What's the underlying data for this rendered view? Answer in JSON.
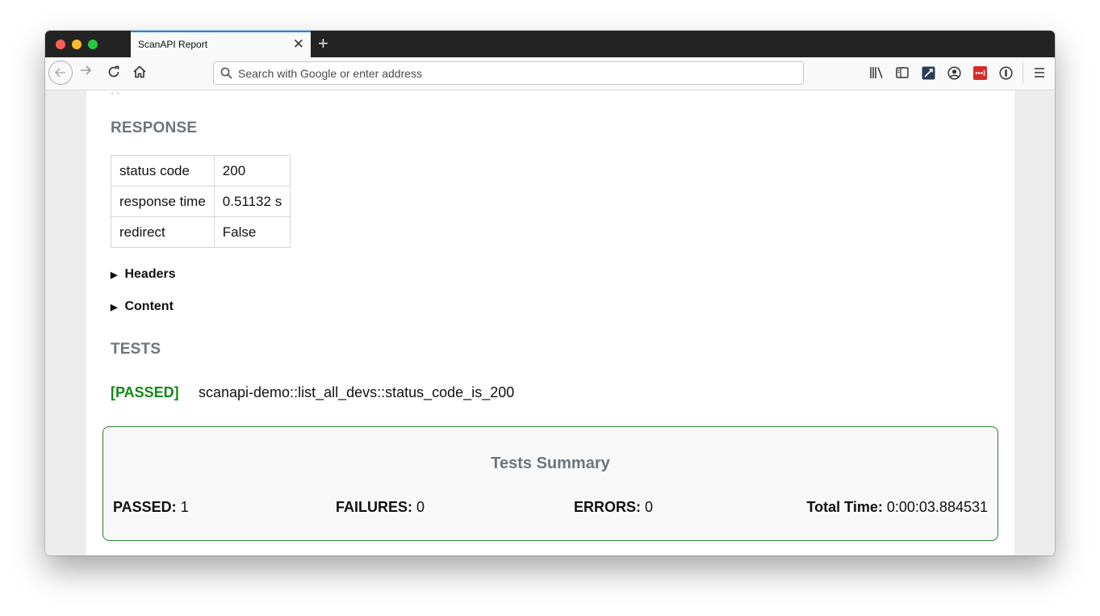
{
  "browser": {
    "tab_title": "ScanAPI Report",
    "tab_close": "✕",
    "new_tab": "+",
    "url_placeholder": "Search with Google or enter address"
  },
  "response": {
    "heading": "RESPONSE",
    "rows": [
      {
        "key": "status code",
        "value": "200"
      },
      {
        "key": "response time",
        "value": "0.51132 s"
      },
      {
        "key": "redirect",
        "value": "False"
      }
    ],
    "headers_label": "Headers",
    "content_label": "Content"
  },
  "tests": {
    "heading": "TESTS",
    "results": [
      {
        "status": "[PASSED]",
        "name": "scanapi-demo::list_all_devs::status_code_is_200"
      }
    ]
  },
  "summary": {
    "title": "Tests Summary",
    "passed_label": "PASSED:",
    "passed_value": "1",
    "failures_label": "FAILURES:",
    "failures_value": "0",
    "errors_label": "ERRORS:",
    "errors_value": "0",
    "time_label": "Total Time:",
    "time_value": "0:00:03.884531"
  },
  "colors": {
    "passed": "#138a13",
    "heading": "#6c757d",
    "summary_border": "#2e7d32",
    "tab_accent": "#0a84ff"
  }
}
